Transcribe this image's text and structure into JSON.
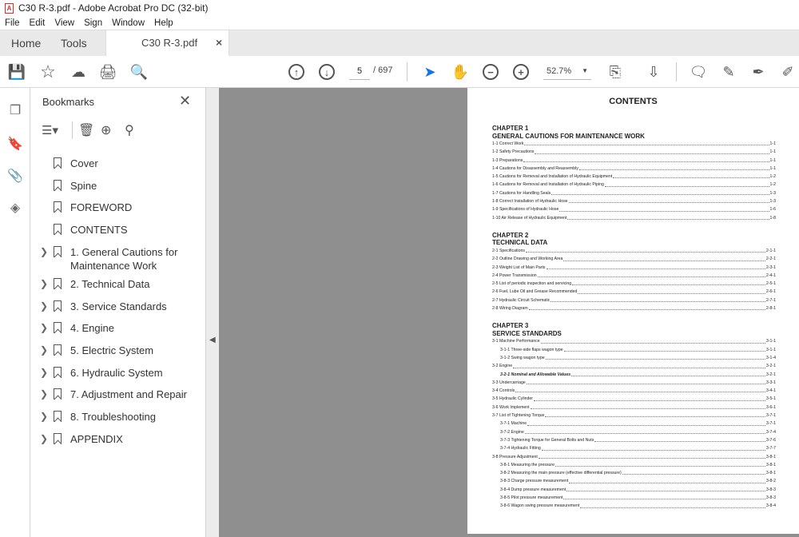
{
  "window": {
    "title": "C30 R-3.pdf - Adobe Acrobat Pro DC (32-bit)"
  },
  "menu": [
    "File",
    "Edit",
    "View",
    "Sign",
    "Window",
    "Help"
  ],
  "tabs": {
    "home": "Home",
    "tools": "Tools",
    "document": "C30 R-3.pdf",
    "close": "×"
  },
  "toolbar": {
    "page_current": "5",
    "page_total": "/ 697",
    "zoom": "52.7%"
  },
  "bookmarks": {
    "title": "Bookmarks",
    "items": [
      {
        "label": "Cover",
        "expandable": false
      },
      {
        "label": "Spine",
        "expandable": false
      },
      {
        "label": "FOREWORD",
        "expandable": false
      },
      {
        "label": "CONTENTS",
        "expandable": false
      },
      {
        "label": "1. General Cautions for Maintenance Work",
        "expandable": true
      },
      {
        "label": "2. Technical Data",
        "expandable": true
      },
      {
        "label": "3. Service Standards",
        "expandable": true
      },
      {
        "label": "4. Engine",
        "expandable": true
      },
      {
        "label": "5. Electric System",
        "expandable": true
      },
      {
        "label": "6. Hydraulic System",
        "expandable": true
      },
      {
        "label": "7. Adjustment and Repair",
        "expandable": true
      },
      {
        "label": "8. Troubleshooting",
        "expandable": true
      },
      {
        "label": "APPENDIX",
        "expandable": true
      }
    ]
  },
  "document": {
    "title": "CONTENTS",
    "chapters": [
      {
        "number": "CHAPTER 1",
        "name": "GENERAL CAUTIONS FOR MAINTENANCE WORK",
        "entries": [
          {
            "t": "1-1 Correct Work",
            "p": "1-1",
            "l": 0
          },
          {
            "t": "1-2 Safety Precautions",
            "p": "1-1",
            "l": 0
          },
          {
            "t": "1-3 Preparations",
            "p": "1-1",
            "l": 0
          },
          {
            "t": "1-4 Cautions for Disassembly and Reassembly",
            "p": "1-1",
            "l": 0
          },
          {
            "t": "1-5 Cautions for Removal and Installation of Hydraulic Equipment",
            "p": "1-2",
            "l": 0
          },
          {
            "t": "1-6 Cautions for Removal and Installation of Hydraulic Piping",
            "p": "1-2",
            "l": 0
          },
          {
            "t": "1-7 Cautions for Handling Seals",
            "p": "1-3",
            "l": 0
          },
          {
            "t": "1-8 Correct Installation of Hydraulic Hose",
            "p": "1-3",
            "l": 0
          },
          {
            "t": "1-9 Specifications of Hydraulic Hose",
            "p": "1-6",
            "l": 0
          },
          {
            "t": "1-10 Air Release of Hydraulic Equipment",
            "p": "1-8",
            "l": 0
          }
        ]
      },
      {
        "number": "CHAPTER 2",
        "name": "TECHNICAL DATA",
        "entries": [
          {
            "t": "2-1 Specifications",
            "p": "2-1-1",
            "l": 0
          },
          {
            "t": "2-2 Outline Drawing and Working Area",
            "p": "2-2-1",
            "l": 0
          },
          {
            "t": "2-3 Weight List of Main Parts",
            "p": "2-3-1",
            "l": 0
          },
          {
            "t": "2-4 Power Transmission",
            "p": "2-4-1",
            "l": 0
          },
          {
            "t": "2-5 List of periodic inspection and servicing",
            "p": "2-5-1",
            "l": 0
          },
          {
            "t": "2-6 Fuel, Lube Oil and Grease Recommended",
            "p": "2-6-1",
            "l": 0
          },
          {
            "t": "2-7 Hydraulic Circuit Schematic",
            "p": "2-7-1",
            "l": 0
          },
          {
            "t": "2-8 Wiring Diagram",
            "p": "2-8-1",
            "l": 0
          }
        ]
      },
      {
        "number": "CHAPTER 3",
        "name": "SERVICE STANDARDS",
        "entries": [
          {
            "t": "3-1 Machine Performance",
            "p": "3-1-1",
            "l": 0
          },
          {
            "t": "3-1-1 Three-side flaps wagon type",
            "p": "3-1-1",
            "l": 1
          },
          {
            "t": "3-1-2 Swing wagon type",
            "p": "3-1-4",
            "l": 1
          },
          {
            "t": "3-2 Engine",
            "p": "3-2-1",
            "l": 0
          },
          {
            "t": "3-2-1 Nominal and Allowable Values",
            "p": "3-2-1",
            "l": 1,
            "italic": true
          },
          {
            "t": "3-3 Undercarriage",
            "p": "3-3-1",
            "l": 0
          },
          {
            "t": "3-4 Controls",
            "p": "3-4-1",
            "l": 0
          },
          {
            "t": "3-5 Hydraulic Cylinder",
            "p": "3-5-1",
            "l": 0
          },
          {
            "t": "3-6 Work Implement",
            "p": "3-6-1",
            "l": 0
          },
          {
            "t": "3-7 List of Tightening Torque",
            "p": "3-7-1",
            "l": 0
          },
          {
            "t": "3-7-1 Machine",
            "p": "3-7-1",
            "l": 1
          },
          {
            "t": "3-7-2 Engine",
            "p": "3-7-4",
            "l": 1
          },
          {
            "t": "3-7-3 Tightening Torque for General Bolts and Nuts",
            "p": "3-7-6",
            "l": 1
          },
          {
            "t": "3-7-4 Hydraulic Fitting",
            "p": "3-7-7",
            "l": 1
          },
          {
            "t": "3-8 Pressure Adjustment",
            "p": "3-8-1",
            "l": 0
          },
          {
            "t": "3-8-1 Measuring the pressure",
            "p": "3-8-1",
            "l": 1
          },
          {
            "t": "3-8-2 Measuring the main pressure (effective differential pressure)",
            "p": "3-8-1",
            "l": 1
          },
          {
            "t": "3-8-3 Charge pressure measurement",
            "p": "3-8-2",
            "l": 1
          },
          {
            "t": "3-8-4 Dump pressure measurement",
            "p": "3-8-3",
            "l": 1
          },
          {
            "t": "3-8-5 Pilot pressure measurement",
            "p": "3-8-3",
            "l": 1
          },
          {
            "t": "3-8-6 Wagon swing pressure measurement",
            "p": "3-8-4",
            "l": 1
          }
        ]
      }
    ]
  },
  "colors": {
    "accent": "#1473e6",
    "pdf_red": "#d0302f",
    "doc_bg": "#8f8f8f"
  }
}
